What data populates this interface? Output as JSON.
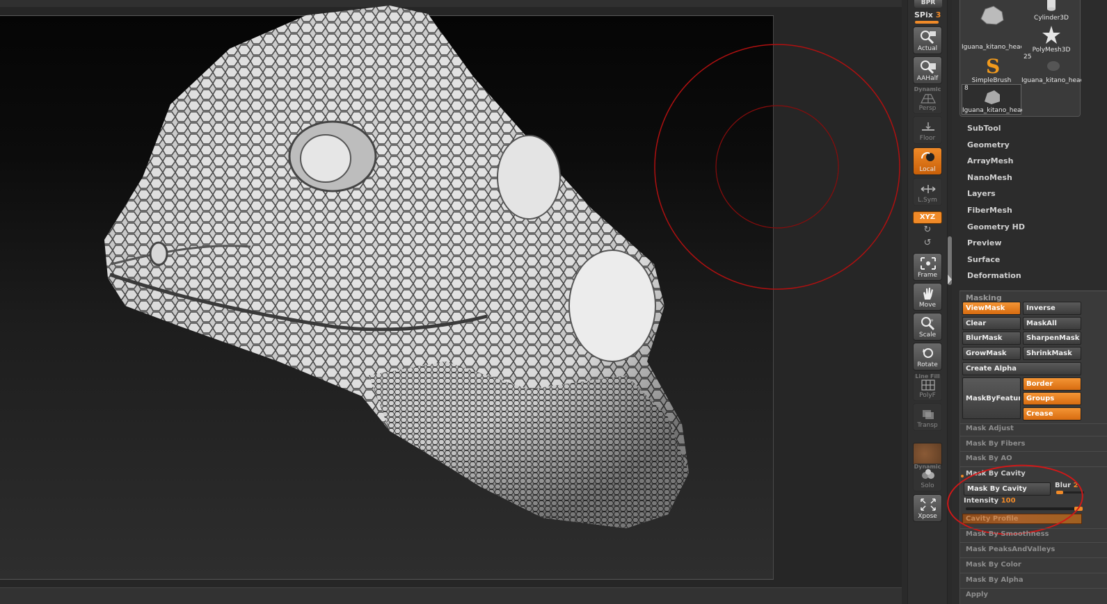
{
  "shelf": {
    "bpr_label": "BPR",
    "spix_label": "SPix",
    "spix_value": "3",
    "buttons": {
      "actual": "Actual",
      "aahalf": "AAHalf",
      "persp": "Persp",
      "persp_top": "Dynamic",
      "floor": "Floor",
      "local": "Local",
      "lsym": "L.Sym",
      "xyz": "XYZ",
      "frame": "Frame",
      "move": "Move",
      "scale": "Scale",
      "rotate": "Rotate",
      "polyf": "PolyF",
      "polyf_top": "Line Fill",
      "transp": "Transp",
      "solo": "Solo",
      "solo_top": "Dynamic",
      "xpose": "Xpose"
    }
  },
  "tool_palette": {
    "thumbs": [
      {
        "label": "Iguana_kitano_heac",
        "count": ""
      },
      {
        "label": "Cylinder3D",
        "count": ""
      },
      {
        "label": "PolyMesh3D",
        "count": ""
      },
      {
        "label": "SimpleBrush",
        "count": ""
      },
      {
        "label": "Iguana_kitano_heac",
        "count": "25"
      },
      {
        "label": "Iguana_kitano_heac",
        "count": "8"
      }
    ],
    "menu": [
      "SubTool",
      "Geometry",
      "ArrayMesh",
      "NanoMesh",
      "Layers",
      "FiberMesh",
      "Geometry HD",
      "Preview",
      "Surface",
      "Deformation"
    ]
  },
  "masking": {
    "title": "Masking",
    "view_mask": "ViewMask",
    "inverse": "Inverse",
    "clear": "Clear",
    "mask_all": "MaskAll",
    "blur_mask": "BlurMask",
    "sharpen_mask": "SharpenMask",
    "grow_mask": "GrowMask",
    "shrink_mask": "ShrinkMask",
    "create_alpha": "Create Alpha",
    "mask_by_feature": "MaskByFeatur",
    "border": "Border",
    "groups": "Groups",
    "crease": "Crease",
    "mask_adjust": "Mask Adjust",
    "mask_by_fibers": "Mask By Fibers",
    "mask_by_ao": "Mask By AO",
    "mask_by_cavity_header": "Mask By Cavity",
    "mask_by_cavity_button": "Mask By Cavity",
    "blur_label": "Blur",
    "blur_value": "2",
    "blur_level": 0.25,
    "intensity_label": "Intensity",
    "intensity_value": "100",
    "cavity_profile": "Cavity Profile",
    "mask_by_smoothness": "Mask By Smoothness",
    "mask_peaks_valleys": "Mask PeaksAndValleys",
    "mask_by_color": "Mask By Color",
    "mask_by_alpha": "Mask By Alpha",
    "apply": "Apply"
  },
  "colors": {
    "accent": "#f08a28",
    "annotation_red": "#d01818",
    "cavity_profile": "#a8602a"
  }
}
